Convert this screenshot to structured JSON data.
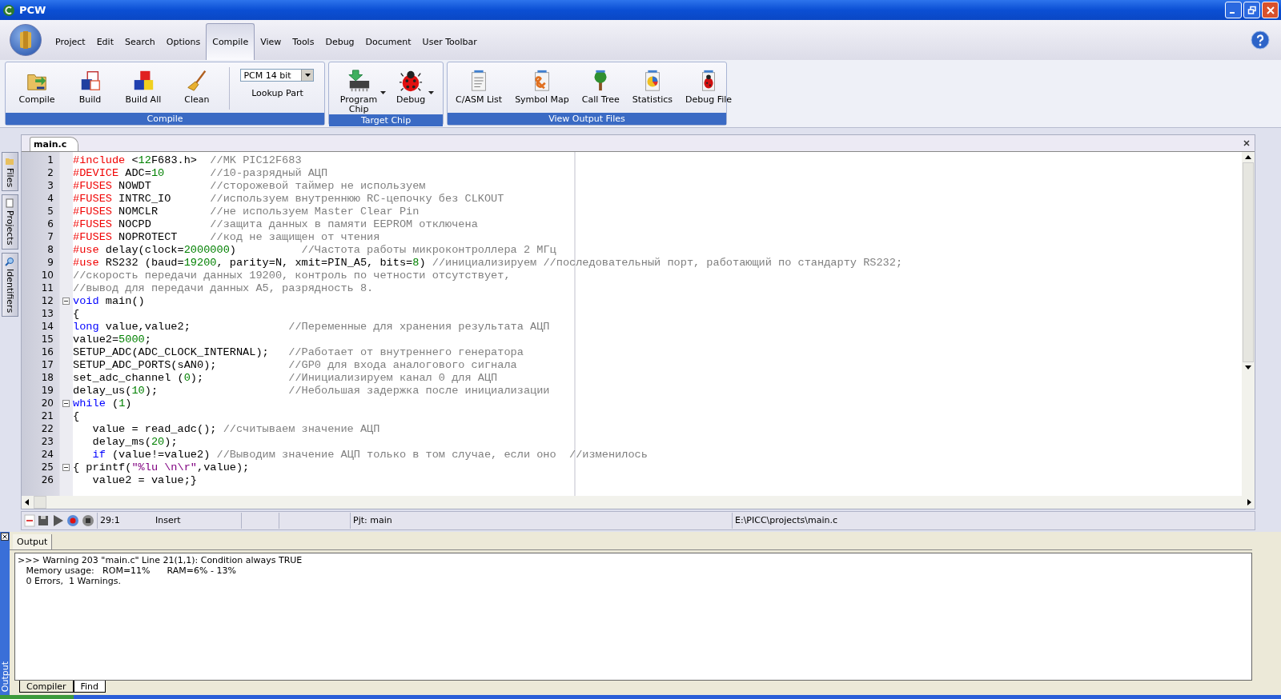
{
  "window": {
    "title": "PCW"
  },
  "menu": [
    {
      "label": "Project",
      "selected": false
    },
    {
      "label": "Edit",
      "selected": false
    },
    {
      "label": "Search",
      "selected": false
    },
    {
      "label": "Options",
      "selected": false
    },
    {
      "label": "Compile",
      "selected": true
    },
    {
      "label": "View",
      "selected": false
    },
    {
      "label": "Tools",
      "selected": false
    },
    {
      "label": "Debug",
      "selected": false
    },
    {
      "label": "Document",
      "selected": false
    },
    {
      "label": "User Toolbar",
      "selected": false
    }
  ],
  "ribbon": [
    {
      "title": "Compile",
      "items": [
        {
          "label": "Compile",
          "dropdown": false
        },
        {
          "label": "Build",
          "dropdown": false
        },
        {
          "label": "Build All",
          "dropdown": false
        },
        {
          "label": "Clean",
          "dropdown": false
        }
      ],
      "chip_select": {
        "value": "PCM 14 bit"
      },
      "lookup": {
        "label": "Lookup Part"
      }
    },
    {
      "title": "Target Chip",
      "items": [
        {
          "label": "Program\nChip",
          "dropdown": true
        },
        {
          "label": "Debug",
          "dropdown": true
        }
      ]
    },
    {
      "title": "View Output Files",
      "items": [
        {
          "label": "C/ASM List",
          "dropdown": false
        },
        {
          "label": "Symbol Map",
          "dropdown": false
        },
        {
          "label": "Call Tree",
          "dropdown": false
        },
        {
          "label": "Statistics",
          "dropdown": false
        },
        {
          "label": "Debug File",
          "dropdown": false
        }
      ]
    }
  ],
  "side_tabs": [
    {
      "label": "Files"
    },
    {
      "label": "Projects"
    },
    {
      "label": "Identifiers"
    }
  ],
  "editor": {
    "tab": "main.c",
    "lines": [
      {
        "number": "1",
        "fold": false,
        "tokens": [
          {
            "kind": "directive",
            "text": "#include"
          },
          {
            "kind": "plain",
            "text": " <"
          },
          {
            "kind": "number",
            "text": "12"
          },
          {
            "kind": "plain",
            "text": "F683.h>  "
          },
          {
            "kind": "comment",
            "text": "//MK PIC12F683"
          }
        ]
      },
      {
        "number": "2",
        "fold": false,
        "tokens": [
          {
            "kind": "directive",
            "text": "#DEVICE"
          },
          {
            "kind": "plain",
            "text": " ADC="
          },
          {
            "kind": "number",
            "text": "10"
          },
          {
            "kind": "comment",
            "text": "       //10-разрядный АЦП"
          }
        ]
      },
      {
        "number": "3",
        "fold": false,
        "tokens": [
          {
            "kind": "directive",
            "text": "#FUSES"
          },
          {
            "kind": "plain",
            "text": " NOWDT         "
          },
          {
            "kind": "comment",
            "text": "//сторожевой таймер не используем"
          }
        ]
      },
      {
        "number": "4",
        "fold": false,
        "tokens": [
          {
            "kind": "directive",
            "text": "#FUSES"
          },
          {
            "kind": "plain",
            "text": " INTRC_IO      "
          },
          {
            "kind": "comment",
            "text": "//используем внутреннюю RC-цепочку без CLKOUT"
          }
        ]
      },
      {
        "number": "5",
        "fold": false,
        "tokens": [
          {
            "kind": "directive",
            "text": "#FUSES"
          },
          {
            "kind": "plain",
            "text": " NOMCLR        "
          },
          {
            "kind": "comment",
            "text": "//не используем Master Clear Pin"
          }
        ]
      },
      {
        "number": "6",
        "fold": false,
        "tokens": [
          {
            "kind": "directive",
            "text": "#FUSES"
          },
          {
            "kind": "plain",
            "text": " NOCPD         "
          },
          {
            "kind": "comment",
            "text": "//защита данных в памяти EEPROM отключена"
          }
        ]
      },
      {
        "number": "7",
        "fold": false,
        "tokens": [
          {
            "kind": "directive",
            "text": "#FUSES"
          },
          {
            "kind": "plain",
            "text": " NOPROTECT     "
          },
          {
            "kind": "comment",
            "text": "//код не защищен от чтения"
          }
        ]
      },
      {
        "number": "8",
        "fold": false,
        "tokens": [
          {
            "kind": "directive",
            "text": "#use"
          },
          {
            "kind": "plain",
            "text": " delay(clock="
          },
          {
            "kind": "number",
            "text": "2000000"
          },
          {
            "kind": "plain",
            "text": ")          "
          },
          {
            "kind": "comment",
            "text": "//Частота работы микроконтроллера 2 МГц"
          }
        ]
      },
      {
        "number": "9",
        "fold": false,
        "tokens": [
          {
            "kind": "directive",
            "text": "#use"
          },
          {
            "kind": "plain",
            "text": " RS232 (baud="
          },
          {
            "kind": "number",
            "text": "19200"
          },
          {
            "kind": "plain",
            "text": ", parity=N, xmit=PIN_A5, bits="
          },
          {
            "kind": "number",
            "text": "8"
          },
          {
            "kind": "plain",
            "text": ") "
          },
          {
            "kind": "comment",
            "text": "//инициализируем //последовательный порт, работающий по стандарту RS232;"
          }
        ]
      },
      {
        "number": "10",
        "fold": false,
        "tokens": [
          {
            "kind": "comment",
            "text": "//скорость передачи данных 19200, контроль по четности отсутствует,"
          }
        ]
      },
      {
        "number": "11",
        "fold": false,
        "tokens": [
          {
            "kind": "comment",
            "text": "//вывод для передачи данных A5, разрядность 8."
          }
        ]
      },
      {
        "number": "12",
        "fold": true,
        "tokens": [
          {
            "kind": "keyword",
            "text": "void"
          },
          {
            "kind": "plain",
            "text": " main()"
          }
        ]
      },
      {
        "number": "13",
        "fold": false,
        "tokens": [
          {
            "kind": "plain",
            "text": "{"
          }
        ]
      },
      {
        "number": "14",
        "fold": false,
        "tokens": [
          {
            "kind": "keyword",
            "text": "long"
          },
          {
            "kind": "plain",
            "text": " value,value2;               "
          },
          {
            "kind": "comment",
            "text": "//Переменные для хранения результата АЦП"
          }
        ]
      },
      {
        "number": "15",
        "fold": false,
        "tokens": [
          {
            "kind": "plain",
            "text": "value2="
          },
          {
            "kind": "number",
            "text": "5000"
          },
          {
            "kind": "plain",
            "text": ";"
          }
        ]
      },
      {
        "number": "16",
        "fold": false,
        "tokens": [
          {
            "kind": "plain",
            "text": "SETUP_ADC(ADC_CLOCK_INTERNAL);   "
          },
          {
            "kind": "comment",
            "text": "//Работает от внутреннего генератора"
          }
        ]
      },
      {
        "number": "17",
        "fold": false,
        "tokens": [
          {
            "kind": "plain",
            "text": "SETUP_ADC_PORTS(sAN0);           "
          },
          {
            "kind": "comment",
            "text": "//GP0 для входа аналогового сигнала"
          }
        ]
      },
      {
        "number": "18",
        "fold": false,
        "tokens": [
          {
            "kind": "plain",
            "text": "set_adc_channel ("
          },
          {
            "kind": "number",
            "text": "0"
          },
          {
            "kind": "plain",
            "text": ");             "
          },
          {
            "kind": "comment",
            "text": "//Инициализируем канал 0 для АЦП"
          }
        ]
      },
      {
        "number": "19",
        "fold": false,
        "tokens": [
          {
            "kind": "plain",
            "text": "delay_us("
          },
          {
            "kind": "number",
            "text": "10"
          },
          {
            "kind": "plain",
            "text": ");                    "
          },
          {
            "kind": "comment",
            "text": "//Небольшая задержка после инициализации"
          }
        ]
      },
      {
        "number": "20",
        "fold": true,
        "tokens": [
          {
            "kind": "keyword",
            "text": "while"
          },
          {
            "kind": "plain",
            "text": " ("
          },
          {
            "kind": "number",
            "text": "1"
          },
          {
            "kind": "plain",
            "text": ")"
          }
        ]
      },
      {
        "number": "21",
        "fold": false,
        "tokens": [
          {
            "kind": "plain",
            "text": "{"
          }
        ]
      },
      {
        "number": "22",
        "fold": false,
        "tokens": [
          {
            "kind": "plain",
            "text": "   value = read_adc(); "
          },
          {
            "kind": "comment",
            "text": "//считываем значение АЦП"
          }
        ]
      },
      {
        "number": "23",
        "fold": false,
        "tokens": [
          {
            "kind": "plain",
            "text": "   delay_ms("
          },
          {
            "kind": "number",
            "text": "20"
          },
          {
            "kind": "plain",
            "text": ");"
          }
        ]
      },
      {
        "number": "24",
        "fold": false,
        "tokens": [
          {
            "kind": "keyword",
            "text": "   if"
          },
          {
            "kind": "plain",
            "text": " (value!=value2) "
          },
          {
            "kind": "comment",
            "text": "//Выводим значение АЦП только в том случае, если оно  //изменилось"
          }
        ]
      },
      {
        "number": "25",
        "fold": true,
        "tokens": [
          {
            "kind": "plain",
            "text": "{ printf("
          },
          {
            "kind": "string",
            "text": "\"%lu \\n\\r\""
          },
          {
            "kind": "plain",
            "text": ",value);"
          }
        ]
      },
      {
        "number": "26",
        "fold": false,
        "tokens": [
          {
            "kind": "plain",
            "text": "   value2 = value;}"
          }
        ]
      }
    ]
  },
  "status_bar": {
    "position": "29:1",
    "mode": "Insert",
    "project": "Pjt: main",
    "path": "E:\\PICC\\projects\\main.c"
  },
  "output": {
    "tab": "Output",
    "lines": [
      ">>> Warning 203 \"main.c\" Line 21(1,1): Condition always TRUE",
      "   Memory usage:   ROM=11%      RAM=6% - 13%",
      "   0 Errors,  1 Warnings."
    ],
    "tabs": [
      {
        "label": "Compiler",
        "selected": true
      },
      {
        "label": "Find",
        "selected": false
      }
    ],
    "side_label": "Output"
  }
}
